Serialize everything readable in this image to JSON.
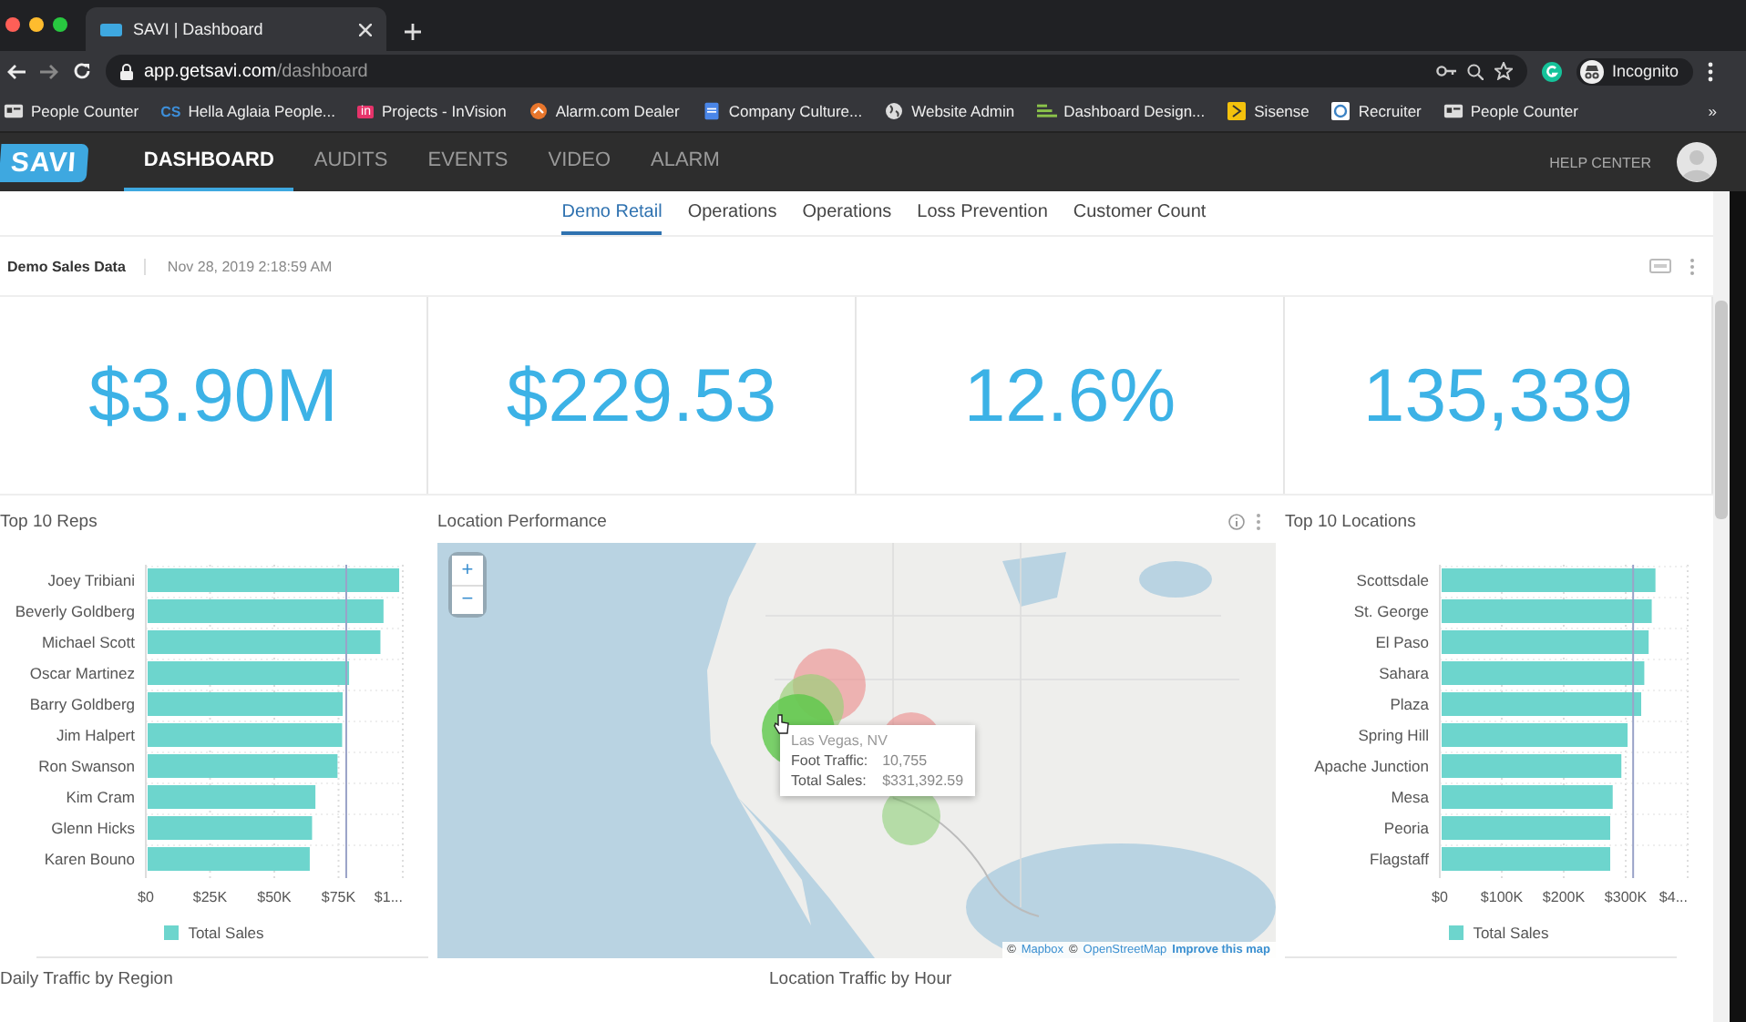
{
  "browser": {
    "tab_title": "SAVI | Dashboard",
    "url_host": "app.getsavi.com",
    "url_path": "/dashboard",
    "profile": "Incognito",
    "more": "»",
    "bookmarks": [
      {
        "label": "People Counter",
        "kind": "card"
      },
      {
        "label": "Hella Aglaia People...",
        "kind": "letters",
        "badge": "CS"
      },
      {
        "label": "Projects - InVision",
        "kind": "tile",
        "badge": "in"
      },
      {
        "label": "Alarm.com Dealer",
        "kind": "orange"
      },
      {
        "label": "Company Culture...",
        "kind": "doc"
      },
      {
        "label": "Website Admin",
        "kind": "globe"
      },
      {
        "label": "Dashboard Design...",
        "kind": "bars"
      },
      {
        "label": "Sisense",
        "kind": "yellow"
      },
      {
        "label": "Recruiter",
        "kind": "chat"
      },
      {
        "label": "People Counter",
        "kind": "card"
      }
    ]
  },
  "app_nav": {
    "logo": "SAVI",
    "help": "HELP CENTER",
    "tabs": [
      {
        "label": "DASHBOARD",
        "selected": true
      },
      {
        "label": "AUDITS",
        "selected": false
      },
      {
        "label": "EVENTS",
        "selected": false
      },
      {
        "label": "VIDEO",
        "selected": false
      },
      {
        "label": "ALARM",
        "selected": false
      }
    ]
  },
  "subtabs": [
    {
      "label": "Demo Retail",
      "selected": true
    },
    {
      "label": "Operations",
      "selected": false
    },
    {
      "label": "Operations",
      "selected": false
    },
    {
      "label": "Loss Prevention",
      "selected": false
    },
    {
      "label": "Customer Count",
      "selected": false
    }
  ],
  "report": {
    "title": "Demo Sales Data",
    "timestamp": "Nov 28, 2019 2:18:59 AM"
  },
  "kpis": [
    "$3.90M",
    "$229.53",
    "12.6%",
    "135,339"
  ],
  "reps": {
    "chart_data": {
      "type": "bar",
      "orientation": "horizontal",
      "title": "Top 10 Reps",
      "categories": [
        "Joey Tribiani",
        "Beverly Goldberg",
        "Michael Scott",
        "Oscar Martinez",
        "Barry Goldberg",
        "Jim Halpert",
        "Ron Swanson",
        "Kim Cram",
        "Glenn Hicks",
        "Karen Bouno"
      ],
      "series": [
        {
          "name": "Total Sales",
          "color": "#6dd5cd",
          "values": [
            98600,
            92500,
            91300,
            79100,
            76600,
            76400,
            74600,
            66000,
            64700,
            63800
          ]
        }
      ],
      "xlim": [
        0,
        100000
      ],
      "xticks": [
        {
          "value": 0,
          "label": "$0"
        },
        {
          "value": 25000,
          "label": "$25K"
        },
        {
          "value": 50000,
          "label": "$50K"
        },
        {
          "value": 75000,
          "label": "$75K"
        },
        {
          "value": 100000,
          "label": "$1..."
        }
      ],
      "grid": true,
      "ref_lines": [
        {
          "axis": "x",
          "value": 78000
        }
      ]
    }
  },
  "map": {
    "title": "Location Performance",
    "zoom_in": "+",
    "zoom_out": "−",
    "tooltip": {
      "title": "Las Vegas, NV",
      "rows": [
        {
          "label": "Foot Traffic:",
          "value": "10,755"
        },
        {
          "label": "Total Sales:",
          "value": "$331,392.59"
        }
      ]
    },
    "attribution": [
      {
        "text": "©",
        "kind": "sign"
      },
      {
        "text": "Mapbox",
        "kind": "link"
      },
      {
        "text": "©",
        "kind": "sign"
      },
      {
        "text": "OpenStreetMap",
        "kind": "link"
      },
      {
        "text": "Improve this map",
        "kind": "strong-link"
      }
    ]
  },
  "locations": {
    "chart_data": {
      "type": "bar",
      "orientation": "horizontal",
      "title": "Top 10 Locations",
      "categories": [
        "Scottsdale",
        "St. George",
        "El Paso",
        "Sahara",
        "Plaza",
        "Spring Hill",
        "Apache Junction",
        "Mesa",
        "Peoria",
        "Flagstaff"
      ],
      "series": [
        {
          "name": "Total Sales",
          "color": "#6dd5cd",
          "values": [
            348000,
            342000,
            337000,
            330000,
            325000,
            303000,
            293000,
            279000,
            275000,
            275000
          ]
        }
      ],
      "xlim": [
        0,
        400000
      ],
      "xticks": [
        {
          "value": 0,
          "label": "$0"
        },
        {
          "value": 100000,
          "label": "$100K"
        },
        {
          "value": 200000,
          "label": "$200K"
        },
        {
          "value": 300000,
          "label": "$300K"
        },
        {
          "value": 400000,
          "label": "$4..."
        }
      ],
      "grid": true,
      "ref_lines": [
        {
          "axis": "x",
          "value": 312000
        }
      ]
    }
  },
  "bottom_titles": [
    "Daily Traffic by Region",
    "Location Traffic by Hour"
  ]
}
